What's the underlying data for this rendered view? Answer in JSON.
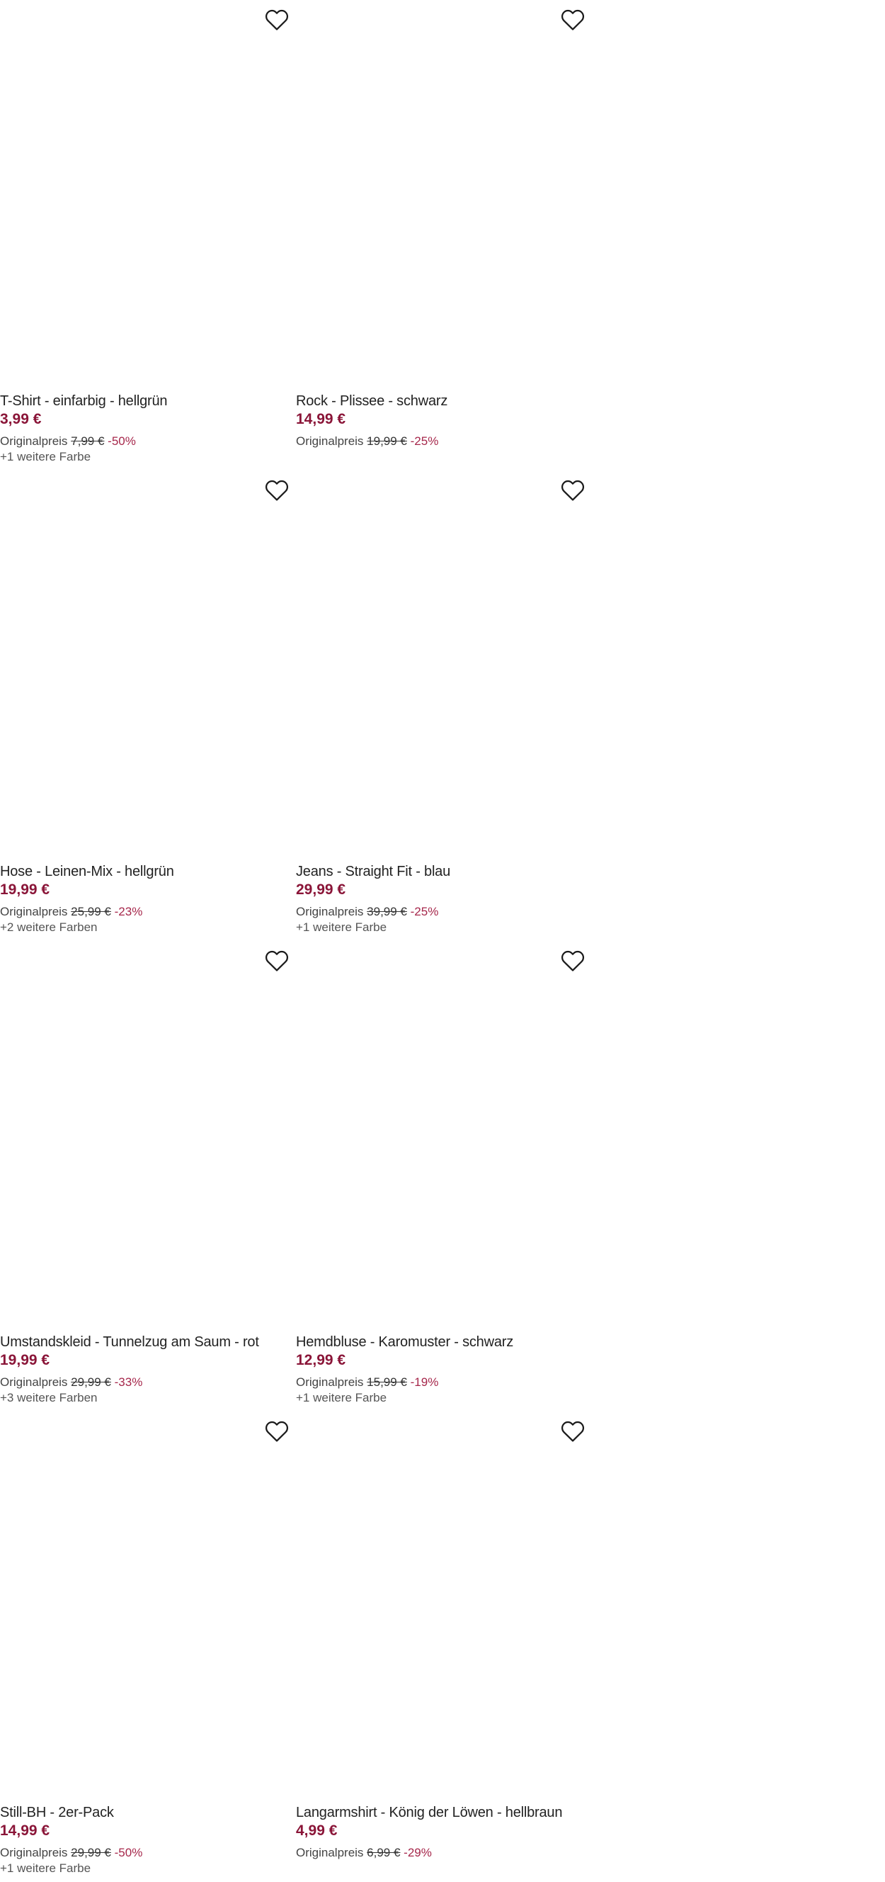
{
  "colors": {
    "price": "#8a1538",
    "discount": "#a6274b",
    "title": "#222222"
  },
  "icons": {
    "wishlist": "heart-outline-icon"
  },
  "products": [
    {
      "title": "T-Shirt - einfarbig - hellgrün",
      "price": "3,99 €",
      "orig_label": "Originalpreis",
      "orig_price": "7,99 €",
      "discount": "-50%",
      "colors_note": "+1 weitere Farbe"
    },
    {
      "title": "Rock - Plissee - schwarz",
      "price": "14,99 €",
      "orig_label": "Originalpreis",
      "orig_price": "19,99 €",
      "discount": "-25%",
      "colors_note": ""
    },
    {
      "title": "Hose - Leinen-Mix - hellgrün",
      "price": "19,99 €",
      "orig_label": "Originalpreis",
      "orig_price": "25,99 €",
      "discount": "-23%",
      "colors_note": "+2 weitere Farben"
    },
    {
      "title": "Jeans - Straight Fit - blau",
      "price": "29,99 €",
      "orig_label": "Originalpreis",
      "orig_price": "39,99 €",
      "discount": "-25%",
      "colors_note": "+1 weitere Farbe"
    },
    {
      "title": "Umstandskleid - Tunnelzug am Saum - rot",
      "price": "19,99 €",
      "orig_label": "Originalpreis",
      "orig_price": "29,99 €",
      "discount": "-33%",
      "colors_note": "+3 weitere Farben"
    },
    {
      "title": "Hemdbluse - Karomuster - schwarz",
      "price": "12,99 €",
      "orig_label": "Originalpreis",
      "orig_price": "15,99 €",
      "discount": "-19%",
      "colors_note": "+1 weitere Farbe"
    },
    {
      "title": "Still-BH - 2er-Pack",
      "price": "14,99 €",
      "orig_label": "Originalpreis",
      "orig_price": "29,99 €",
      "discount": "-50%",
      "colors_note": "+1 weitere Farbe"
    },
    {
      "title": "Langarmshirt - König der Löwen - hellbraun",
      "price": "4,99 €",
      "orig_label": "Originalpreis",
      "orig_price": "6,99 €",
      "discount": "-29%",
      "colors_note": ""
    }
  ]
}
